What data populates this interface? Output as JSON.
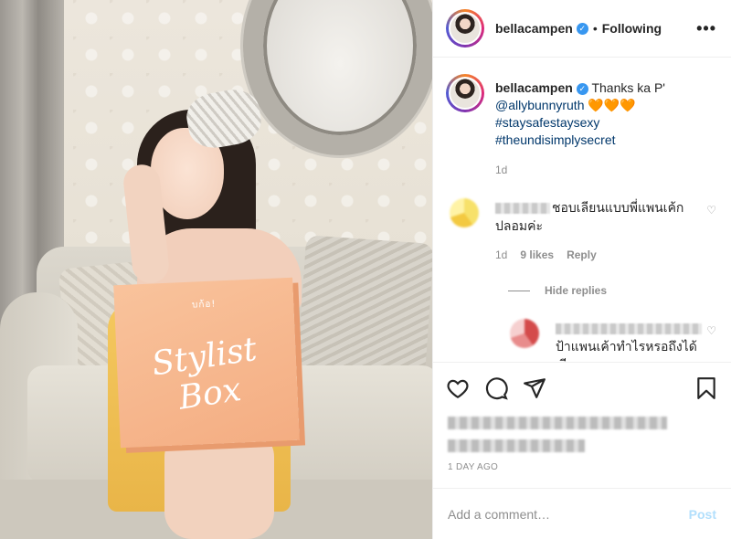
{
  "post": {
    "username": "bellacampen",
    "follow_status": "Following",
    "more_icon": "more-options-icon",
    "verified_icon": "verified-badge-icon",
    "separator": "•"
  },
  "photo": {
    "box_brand": "บก้อ!",
    "box_title": "Stylist Box"
  },
  "caption": {
    "username": "bellacampen",
    "text": "Thanks ka P'",
    "mention": "@allybunnyruth",
    "hearts": "🧡🧡🧡",
    "hashtag1": "#staysafestaysexy",
    "hashtag2": "#theundisimplysecret",
    "timestamp": "1d"
  },
  "comments": [
    {
      "text": "ชอบเลียนแบบพี่แพนเค้กปลอมค่ะ",
      "time": "1d",
      "likes": "9 likes",
      "reply": "Reply"
    }
  ],
  "hide_replies": "Hide replies",
  "replies": [
    {
      "text": "ป้าแพนเค้าทำไรหรอถึงได้เรียนแบบ"
    }
  ],
  "actions": {
    "like_icon": "heart-icon",
    "comment_icon": "comment-icon",
    "share_icon": "share-icon",
    "save_icon": "bookmark-icon"
  },
  "post_date": "1 DAY AGO",
  "add_comment": {
    "placeholder": "Add a comment…",
    "post_label": "Post"
  },
  "colors": {
    "link": "#00376b",
    "muted": "#8e8e8e",
    "verified": "#3897f0",
    "post_button_disabled": "#b2dffc",
    "border": "#efefef"
  }
}
